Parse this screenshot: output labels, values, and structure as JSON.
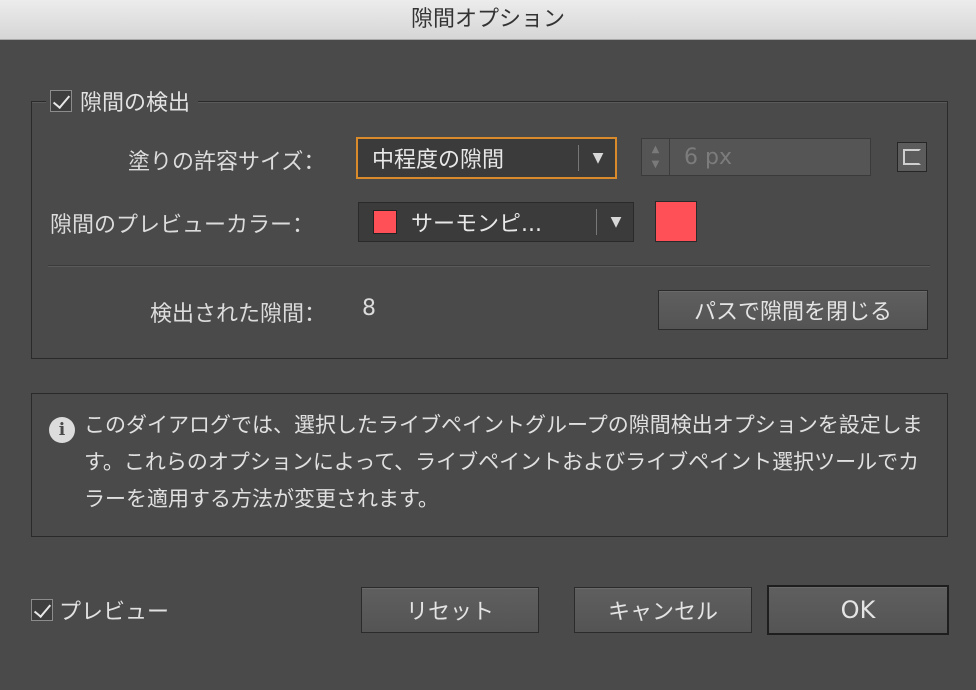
{
  "window": {
    "title": "隙間オプション"
  },
  "gap_detection": {
    "checkbox_label": "隙間の検出",
    "checked": true,
    "fill_tolerance": {
      "label": "塗りの許容サイズ：",
      "selected": "中程度の隙間",
      "custom_value": "6 px"
    },
    "preview_color": {
      "label": "隙間のプレビューカラー：",
      "selected": "サーモンピ...",
      "color": "#ff5058"
    },
    "gaps_found": {
      "label": "検出された隙間：",
      "count": "8"
    },
    "close_gaps_button": "パスで隙間を閉じる"
  },
  "info": {
    "icon": "info-icon",
    "text": "このダイアログでは、選択したライブペイントグループの隙間検出オプションを設定します。これらのオプションによって、ライブペイントおよびライブペイント選択ツールでカラーを適用する方法が変更されます。"
  },
  "footer": {
    "preview_label": "プレビュー",
    "preview_checked": true,
    "reset_button": "リセット",
    "cancel_button": "キャンセル",
    "ok_button": "OK"
  }
}
